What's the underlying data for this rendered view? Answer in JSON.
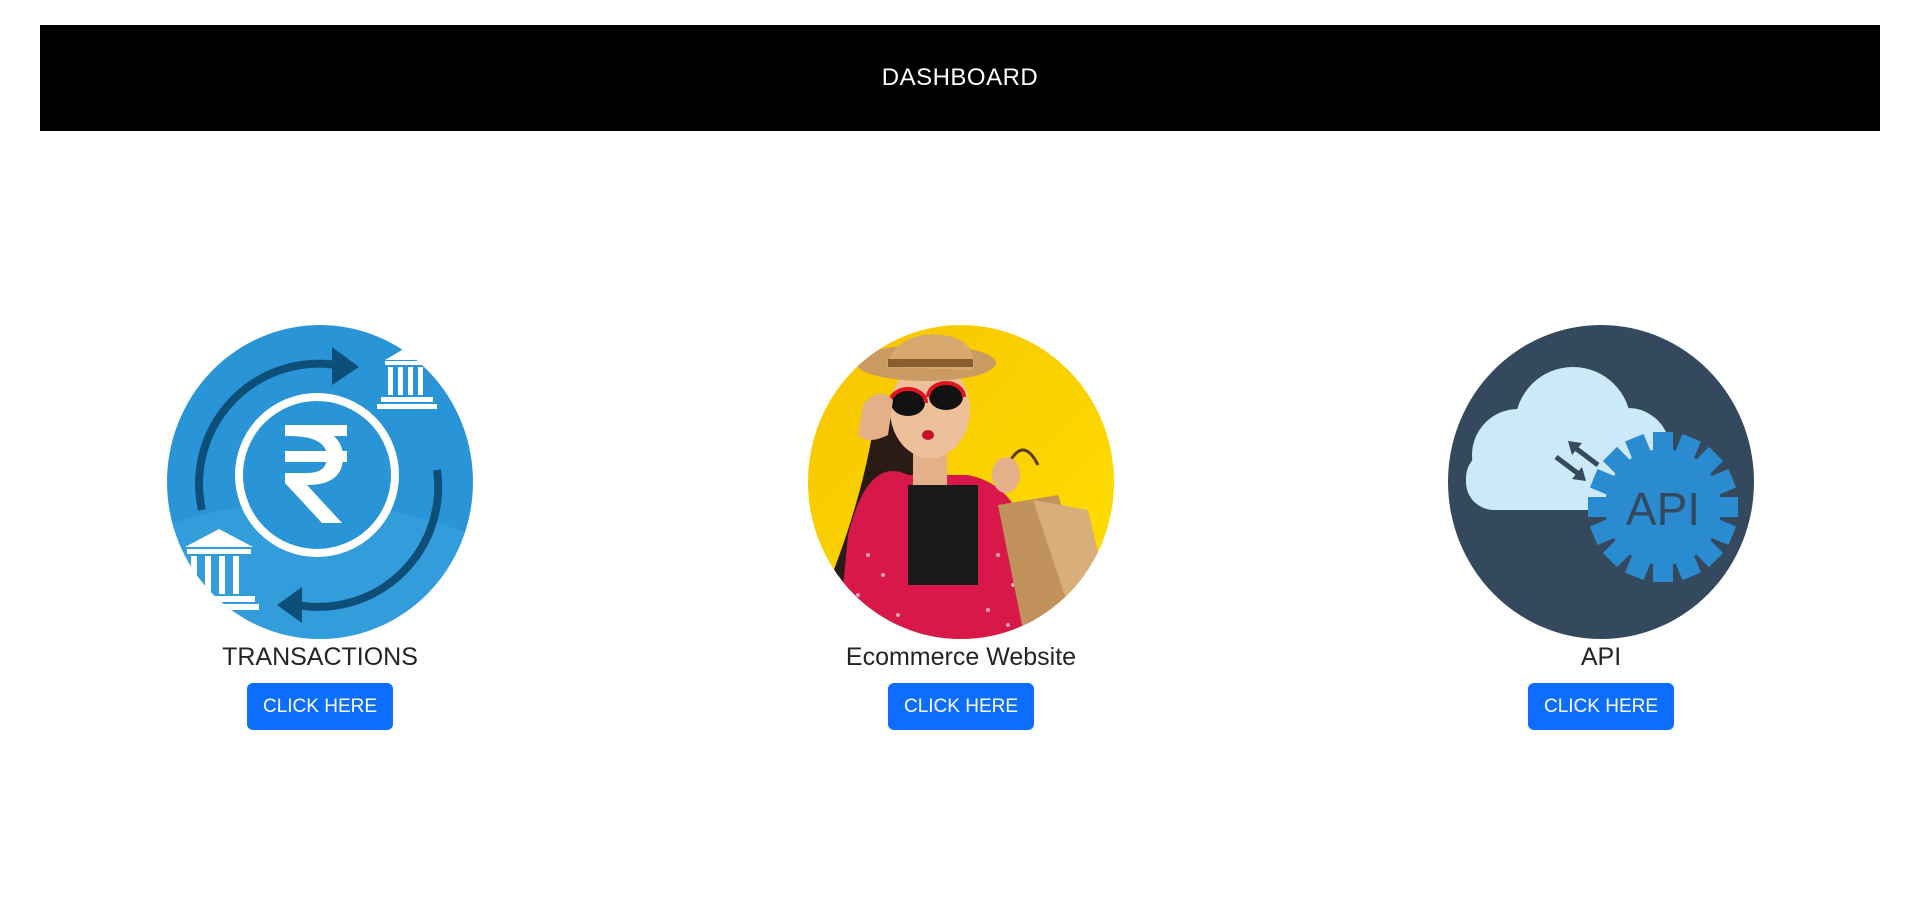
{
  "header": {
    "title": "DASHBOARD"
  },
  "cards": [
    {
      "title": "TRANSACTIONS",
      "button_label": "CLICK HERE",
      "icon": "rupee-transfer-icon"
    },
    {
      "title": "Ecommerce Website",
      "button_label": "CLICK HERE",
      "icon": "shopping-woman-image"
    },
    {
      "title": "API",
      "button_label": "CLICK HERE",
      "icon": "cloud-api-gear-icon",
      "icon_text": "API"
    }
  ],
  "colors": {
    "header_bg": "#000000",
    "button_bg": "#0d6efd",
    "transactions_bg": "#2a95d6",
    "ecommerce_bg": "#fdd400",
    "api_bg": "#34495e"
  }
}
